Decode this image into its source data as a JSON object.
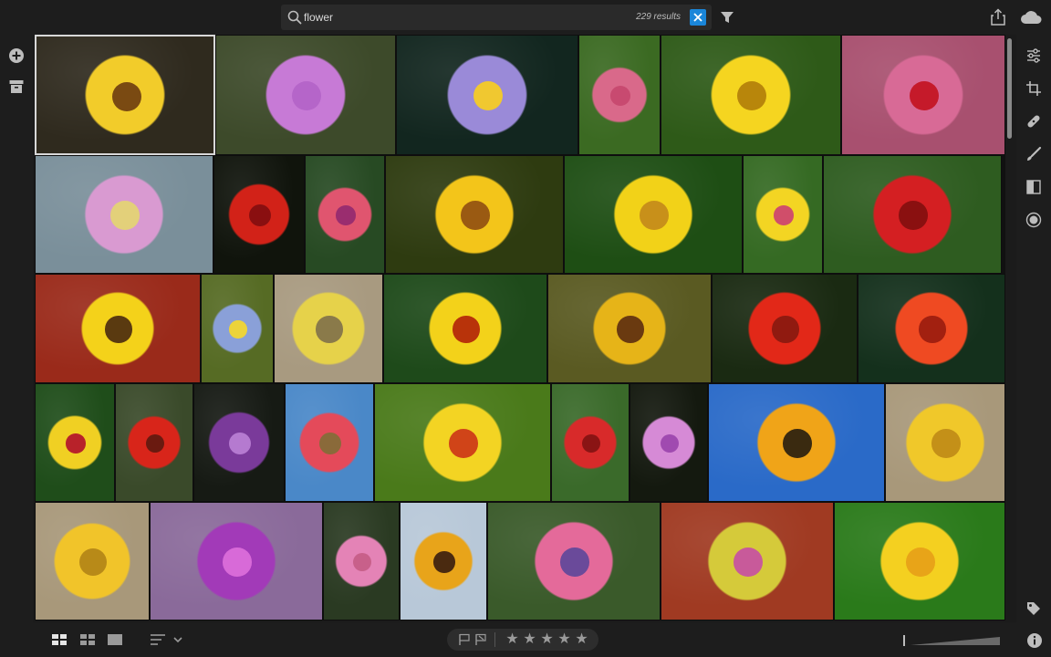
{
  "search": {
    "query": "flower",
    "result_count": "229 results"
  },
  "toolbar": {
    "icons": [
      "search-icon",
      "clear-search-icon",
      "filter-icon",
      "share-icon",
      "cloud-icon"
    ]
  },
  "left_rail": {
    "icons": [
      "add-photos-icon",
      "archive-icon"
    ]
  },
  "right_rail": {
    "icons": [
      "edit-sliders-icon",
      "crop-icon",
      "healing-icon",
      "brush-icon",
      "linear-gradient-icon",
      "radial-gradient-icon",
      "keyword-tag-icon",
      "info-icon"
    ]
  },
  "bottom_bar": {
    "view_modes": [
      "square-grid-view",
      "photo-grid-view",
      "detail-view"
    ],
    "sort_icon": "sort-icon",
    "flag_icons": [
      "pick-flag-icon",
      "reject-flag-icon"
    ],
    "stars": [
      "★",
      "★",
      "★",
      "★",
      "★"
    ]
  },
  "photos": [
    {
      "bg": "#2f2a1e",
      "flower": "#f2cc2a",
      "center": "#7a4a12"
    },
    {
      "bg": "#3d4a2a",
      "flower": "#c77ad6",
      "center": "#b565c9"
    },
    {
      "bg": "#12261f",
      "flower": "#9a8ad8",
      "center": "#f0c830"
    },
    {
      "bg": "#3b6a22",
      "flower": "#d9698a",
      "center": "#c84a70"
    },
    {
      "bg": "#2e5a18",
      "flower": "#f5d520",
      "center": "#b8860b"
    },
    {
      "bg": "#a8506f",
      "flower": "#d86a96",
      "center": "#c51a2a"
    },
    {
      "bg": "#7a8f9a",
      "flower": "#d99ad1",
      "center": "#e3d07a"
    },
    {
      "bg": "#10140c",
      "flower": "#d22218",
      "center": "#8a0f10"
    },
    {
      "bg": "#274a23",
      "flower": "#e0556f",
      "center": "#9a2d6f"
    },
    {
      "bg": "#2e3b10",
      "flower": "#f3c51a",
      "center": "#9a5a12"
    },
    {
      "bg": "#1e4e14",
      "flower": "#f2d218",
      "center": "#c8901a"
    },
    {
      "bg": "#356a23",
      "flower": "#f3d523",
      "center": "#d04e6a"
    },
    {
      "bg": "#2e5c20",
      "flower": "#d41f22",
      "center": "#8a1010"
    },
    {
      "bg": "#9a2a1a",
      "flower": "#f4d21a",
      "center": "#5a3a10"
    },
    {
      "bg": "#566b24",
      "flower": "#8aa0d8",
      "center": "#ecd33a"
    },
    {
      "bg": "#a89a80",
      "flower": "#e6d24a",
      "center": "#8a7a4a"
    },
    {
      "bg": "#1e4a1a",
      "flower": "#f3d21a",
      "center": "#b8330a"
    },
    {
      "bg": "#5a5a22",
      "flower": "#e6b418",
      "center": "#6a3a10"
    },
    {
      "bg": "#1a2a12",
      "flower": "#e22818",
      "center": "#901a10"
    },
    {
      "bg": "#14301c",
      "flower": "#ef4a22",
      "center": "#a22010"
    },
    {
      "bg": "#1f4d1a",
      "flower": "#f0d023",
      "center": "#b8222a"
    },
    {
      "bg": "#3a4a2a",
      "flower": "#d8251a",
      "center": "#6a1a10"
    },
    {
      "bg": "#161a14",
      "flower": "#7a3a9a",
      "center": "#b57ad0"
    },
    {
      "bg": "#4a88c8",
      "flower": "#e44a5a",
      "center": "#8a6a3a"
    },
    {
      "bg": "#4a7a1a",
      "flower": "#f3d423",
      "center": "#d04418"
    },
    {
      "bg": "#3a6a2a",
      "flower": "#d82a2a",
      "center": "#8a1414"
    },
    {
      "bg": "#14190f",
      "flower": "#d68ad6",
      "center": "#a04ab0"
    },
    {
      "bg": "#2a6ac8",
      "flower": "#f0a418",
      "center": "#3a2a10"
    },
    {
      "bg": "#a8987a",
      "flower": "#f0c82a",
      "center": "#c49018"
    },
    {
      "bg": "#a8987a",
      "flower": "#f1c42a",
      "center": "#b88a18"
    },
    {
      "bg": "#8a6a9a",
      "flower": "#a23ab8",
      "center": "#d86ad8"
    },
    {
      "bg": "#2a3a22",
      "flower": "#e483b6",
      "center": "#c8608a"
    },
    {
      "bg": "#b8c8d8",
      "flower": "#e8a41a",
      "center": "#4a2a10"
    },
    {
      "bg": "#3a5a2a",
      "flower": "#e46a9a",
      "center": "#6a4a9a"
    },
    {
      "bg": "#a03a22",
      "flower": "#d5ca3a",
      "center": "#c85a9a"
    },
    {
      "bg": "#2a7a1a",
      "flower": "#f4d020",
      "center": "#e8a418"
    }
  ]
}
